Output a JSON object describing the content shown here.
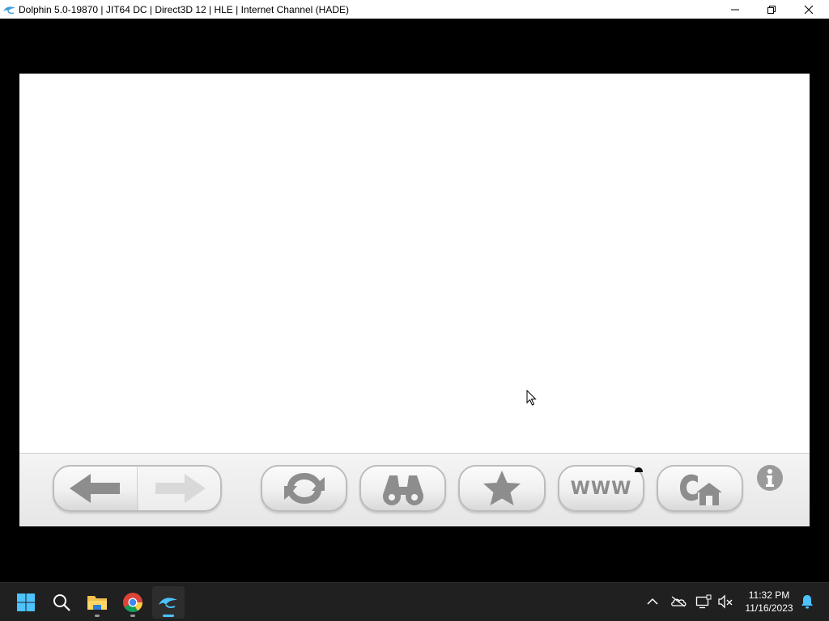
{
  "window": {
    "title": "Dolphin 5.0-19870 | JIT64 DC | Direct3D 12 | HLE | Internet Channel (HADE)",
    "controls": [
      "minimize",
      "maximize",
      "close"
    ]
  },
  "toolbar": {
    "buttons": [
      {
        "name": "back",
        "icon": "arrow-left-icon"
      },
      {
        "name": "forward",
        "icon": "arrow-right-icon",
        "state": "disabled"
      },
      {
        "name": "reload",
        "icon": "reload-icon"
      },
      {
        "name": "search",
        "icon": "binoculars-icon"
      },
      {
        "name": "favorites",
        "icon": "star-icon"
      },
      {
        "name": "web-address",
        "icon": "www-icon",
        "label": "WWW"
      },
      {
        "name": "start-page",
        "icon": "home-icon"
      }
    ],
    "info_icon": "info-icon"
  },
  "taskbar": {
    "apps": [
      {
        "name": "start",
        "icon": "windows-icon"
      },
      {
        "name": "search",
        "icon": "search-icon"
      },
      {
        "name": "file-explorer",
        "icon": "folder-icon"
      },
      {
        "name": "chrome",
        "icon": "chrome-icon"
      },
      {
        "name": "dolphin",
        "icon": "dolphin-icon",
        "active": true
      }
    ],
    "tray": [
      "chevron-up-icon",
      "onedrive-icon",
      "network-icon",
      "volume-muted-icon"
    ],
    "clock": {
      "time": "11:32 PM",
      "date": "11/16/2023"
    },
    "notification_icon": "bell-icon"
  },
  "colors": {
    "accent": "#4cc2ff",
    "icon_gray": "#8d8d8d",
    "taskbar_bg": "#202020"
  }
}
